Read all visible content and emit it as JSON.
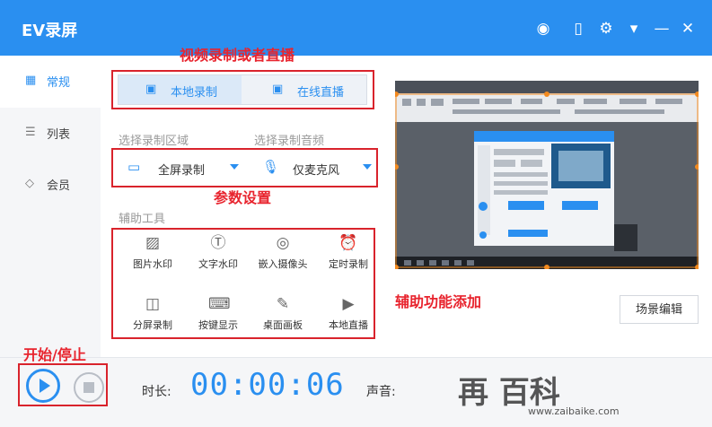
{
  "app": {
    "title": "EV录屏"
  },
  "titlebar": {
    "icons": [
      "user-icon",
      "phone-icon",
      "settings-icon",
      "menu-icon",
      "minimize-icon",
      "close-icon"
    ],
    "glyphs": [
      "◉",
      "▯",
      "⚙",
      "▾",
      "—",
      "✕"
    ]
  },
  "sidebar": {
    "items": [
      {
        "label": "常规",
        "icon": "grid-icon",
        "glyph": "▦"
      },
      {
        "label": "列表",
        "icon": "list-icon",
        "glyph": "☰"
      },
      {
        "label": "会员",
        "icon": "diamond-icon",
        "glyph": "◇"
      }
    ]
  },
  "annotations": {
    "mode": "视频录制或者直播",
    "params": "参数设置",
    "tools": "辅助功能添加",
    "start_stop": "开始/停止"
  },
  "mode_tabs": {
    "local": {
      "label": "本地录制",
      "glyph": "▣"
    },
    "live": {
      "label": "在线直播",
      "glyph": "▣"
    }
  },
  "record_area": {
    "label": "选择录制区域",
    "value": "全屏录制",
    "glyph": "▭"
  },
  "record_audio": {
    "label": "选择录制音频",
    "value": "仅麦克风",
    "glyph": "🎙"
  },
  "tools": {
    "title": "辅助工具",
    "items": [
      {
        "label": "图片水印",
        "icon": "image-icon",
        "glyph": "▨"
      },
      {
        "label": "文字水印",
        "icon": "text-icon",
        "glyph": "Ⓣ"
      },
      {
        "label": "嵌入摄像头",
        "icon": "webcam-icon",
        "glyph": "◎"
      },
      {
        "label": "定时录制",
        "icon": "alarm-clock-icon",
        "glyph": "⏰"
      },
      {
        "label": "分屏录制",
        "icon": "split-screen-icon",
        "glyph": "◫"
      },
      {
        "label": "按键显示",
        "icon": "keyboard-icon",
        "glyph": "⌨"
      },
      {
        "label": "桌面画板",
        "icon": "drawing-board-icon",
        "glyph": "✎"
      },
      {
        "label": "本地直播",
        "icon": "local-live-icon",
        "glyph": "▶"
      }
    ]
  },
  "preview": {
    "scene_button": "场景编辑"
  },
  "bottom": {
    "duration_label": "时长:",
    "duration_value": "00:00:06",
    "sound_label": "声音:"
  },
  "watermark": {
    "title": "再 百科",
    "url": "www.zaibaike.com"
  },
  "colors": {
    "accent": "#2a8ff0",
    "annotation": "#e8242e",
    "handle": "#f28a1f"
  }
}
